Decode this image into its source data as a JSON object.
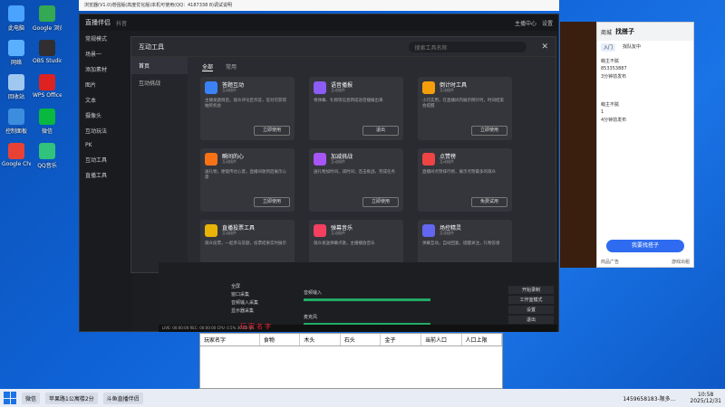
{
  "desktop": {
    "icons": [
      {
        "label": "此电脑",
        "color": "#4aa3ff"
      },
      {
        "label": "网络",
        "color": "#5ab0ff"
      },
      {
        "label": "回收站",
        "color": "#9fc7ef"
      },
      {
        "label": "控制面板",
        "color": "#3c8dde"
      },
      {
        "label": "Google Chrome",
        "color": "#e94235"
      },
      {
        "label": "Google 浏览器",
        "color": "#34a853"
      },
      {
        "label": "OBS Studio",
        "color": "#302e31"
      },
      {
        "label": "WPS Office",
        "color": "#d22"
      },
      {
        "label": "微信",
        "color": "#09b83e"
      },
      {
        "label": "QQ音乐",
        "color": "#31c27c"
      }
    ]
  },
  "top_titlebar": {
    "text": "浏览器(V1.0)增强版(高度优化版)本机可使用(QQ：4187338 8)调试说明"
  },
  "app": {
    "title": "直播伴侣",
    "subtitle": "抖音",
    "header_right": [
      "主播中心",
      "设置"
    ],
    "sidebar": [
      "常规模式",
      "场景一",
      "添加素材",
      "图片",
      "文本",
      "摄像头",
      "互动玩法",
      "PK",
      "互动工具",
      "直播工具"
    ]
  },
  "modal": {
    "title": "互动工具",
    "search_placeholder": "搜索工具名称",
    "left_nav": [
      "首页",
      "互动挑战"
    ],
    "tabs": [
      "全部",
      "常用"
    ],
    "cards": [
      {
        "name": "答题互动",
        "tag": "互动插件",
        "desc": "主播发题目后，观众评论区作答，答对可获得抽奖机会",
        "button": "立即使用",
        "color": "#3b82f6"
      },
      {
        "name": "语音播报",
        "tag": "互动插件",
        "desc": "将弹幕、礼物等信息转成语音播报出来",
        "button": "退出",
        "color": "#8b5cf6"
      },
      {
        "name": "倒计时工具",
        "tag": "互动插件",
        "desc": "小巧实用，在直播间内展示倒计时，时间结束会提醒",
        "button": "立即使用",
        "color": "#f59e0b"
      },
      {
        "name": "瞬间的心",
        "tag": "互动插件",
        "desc": "送礼物，便能传达心意，直播间收到后展示心意",
        "button": "立即使用",
        "color": "#f97316"
      },
      {
        "name": "加减挑战",
        "tag": "互动插件",
        "desc": "送礼物加时间，减时间；连击挑战，完成任务",
        "button": "立即使用",
        "color": "#a855f7"
      },
      {
        "name": "点赞榜",
        "tag": "互动插件",
        "desc": "直播间点赞排行榜，展示点赞最多的观众",
        "button": "免费试用",
        "color": "#ef4444"
      },
      {
        "name": "直播投票工具",
        "tag": "互动插件",
        "desc": "观众投票，一起参与答题，投票结果实时展示",
        "button": "立即使用",
        "color": "#eab308"
      },
      {
        "name": "弹幕音乐",
        "tag": "互动插件",
        "desc": "观众发送弹幕点歌，主播播放音乐",
        "button": "立即使用",
        "color": "#f43f5e"
      },
      {
        "name": "场控精灵",
        "tag": "互动插件",
        "desc": "弹幕互动，自动回复，提醒关注，礼物答谢",
        "button": "立即使用",
        "color": "#6366f1"
      }
    ]
  },
  "lower_panel": {
    "rows": [
      "全屏",
      "窗口采集",
      "音频输入采集",
      "显示器采集"
    ],
    "mixer": [
      "音频输入",
      "麦克风"
    ],
    "right_buttons": [
      "开始录制",
      "工作室模式",
      "设置",
      "退出"
    ]
  },
  "statusbar": "LIVE: 00:00:00  REC: 00:00:00  CPU: 0.5%  30.00 fps",
  "red_text": "玩家名字",
  "table": {
    "headers": [
      "玩家名字",
      "食物",
      "木头",
      "石头",
      "金子",
      "当前人口",
      "人口上限"
    ]
  },
  "rpanel": {
    "nav": [
      "商城",
      "找搭子"
    ],
    "title": "找搭子",
    "tabs": [
      "入门",
      "找队友中"
    ],
    "items": [
      "萌主不腻",
      "853353887",
      "3分钟前发布",
      "萌主不腻",
      "1",
      "4分钟前发布"
    ],
    "button": "我要找搭子",
    "footer": [
      "商品广告",
      "游戏出租"
    ]
  },
  "taskbar": {
    "apps": [
      "微信",
      "苹果路1公寓楼2分",
      "斗鱼直播伴侣"
    ],
    "tray": "1459658183-限多...",
    "time": "10:58",
    "date": "2025/12/31"
  }
}
